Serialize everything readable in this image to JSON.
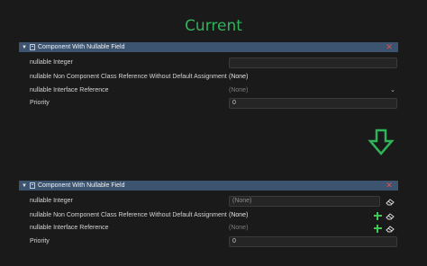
{
  "title": "Current",
  "panels": [
    {
      "header": "Component With Nullable Field",
      "rows": [
        {
          "label": "nullable Integer",
          "value": ""
        },
        {
          "label": "nullable Non Component Class Reference Without Default Assignment",
          "value": "(None)"
        },
        {
          "label": "nullable Interface Reference",
          "value": "(None)"
        },
        {
          "label": "Priority",
          "value": "0"
        }
      ]
    },
    {
      "header": "Component With Nullable Field",
      "rows": [
        {
          "label": "nullable Integer",
          "value": "(None)"
        },
        {
          "label": "nullable Non Component Class Reference Without Default Assignment",
          "value": "(None)"
        },
        {
          "label": "nullable Interface Reference",
          "value": "(None)"
        },
        {
          "label": "Priority",
          "value": "0"
        }
      ]
    }
  ],
  "icons": {
    "foldout": "triangle-down-icon",
    "component": "script-component-icon",
    "close": "close-icon",
    "add": "plus-icon",
    "clear": "eraser-icon",
    "dropdown": "chevron-down-icon",
    "transition": "arrow-down-icon"
  },
  "colors": {
    "background": "#1a1a1a",
    "header": "#3d5470",
    "title": "#2fb45a",
    "close": "#e05252",
    "add": "#3fc94f",
    "arrow": "#2fb45a"
  }
}
